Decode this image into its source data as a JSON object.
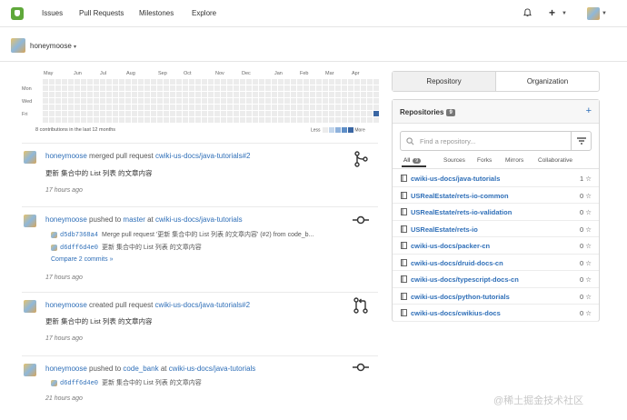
{
  "nav": {
    "items": [
      "Issues",
      "Pull Requests",
      "Milestones",
      "Explore"
    ],
    "plus_label": "+"
  },
  "context": {
    "username": "honeymoose",
    "caret": "▾"
  },
  "heatmap": {
    "months": [
      "May",
      "Jun",
      "Jul",
      "Aug",
      "Sep",
      "Oct",
      "Nov",
      "Dec",
      "Jan",
      "Feb",
      "Mar",
      "Apr"
    ],
    "days": [
      "Mon",
      "Wed",
      "Fri"
    ],
    "caption": "8 contributions in the last 12 months",
    "legend_less": "Less",
    "legend_more": "More",
    "legend_colors": [
      "#ececec",
      "#c3d6ec",
      "#8fb2dc",
      "#5f8fc8",
      "#3a66a3"
    ]
  },
  "feed": [
    {
      "user": "honeymoose",
      "action": "merged pull request",
      "target": "cwiki-us-docs/java-tutorials#2",
      "message": "更新 集合中的 List 列表 的文章内容",
      "time": "17 hours ago"
    },
    {
      "user": "honeymoose",
      "action": "pushed to",
      "branch": "master",
      "at": "at",
      "target": "cwiki-us-docs/java-tutorials",
      "commits": [
        {
          "sha": "d5db7368a4",
          "text": "Merge pull request '更新 集合中的 List 列表 的文章内容' (#2) from code_b..."
        },
        {
          "sha": "d6dff6d4e0",
          "text": "更新 集合中的 List 列表 的文章内容"
        }
      ],
      "compare": "Compare 2 commits »",
      "time": "17 hours ago"
    },
    {
      "user": "honeymoose",
      "action": "created pull request",
      "target": "cwiki-us-docs/java-tutorials#2",
      "message": "更新 集合中的 List 列表 的文章内容",
      "time": "17 hours ago"
    },
    {
      "user": "honeymoose",
      "action": "pushed to",
      "branch": "code_bank",
      "at": "at",
      "target": "cwiki-us-docs/java-tutorials",
      "commits": [
        {
          "sha": "d6dff6d4e0",
          "text": "更新 集合中的 List 列表 的文章内容"
        }
      ],
      "time": "21 hours ago"
    }
  ],
  "side": {
    "tabs": [
      "Repository",
      "Organization"
    ],
    "repos_title": "Repositories",
    "repos_count": "9",
    "search_placeholder": "Find a repository...",
    "filters": [
      "All",
      "Sources",
      "Forks",
      "Mirrors",
      "Collaborative"
    ],
    "all_count": "9",
    "repos": [
      {
        "name": "cwiki-us-docs/java-tutorials",
        "stars": "1"
      },
      {
        "name": "USRealEstate/rets-io-common",
        "stars": "0"
      },
      {
        "name": "USRealEstate/rets-io-validation",
        "stars": "0"
      },
      {
        "name": "USRealEstate/rets-io",
        "stars": "0"
      },
      {
        "name": "cwiki-us-docs/packer-cn",
        "stars": "0"
      },
      {
        "name": "cwiki-us-docs/druid-docs-cn",
        "stars": "0"
      },
      {
        "name": "cwiki-us-docs/typescript-docs-cn",
        "stars": "0"
      },
      {
        "name": "cwiki-us-docs/python-tutorials",
        "stars": "0"
      },
      {
        "name": "cwiki-us-docs/cwikius-docs",
        "stars": "0"
      }
    ]
  },
  "watermark": "@稀土掘金技术社区",
  "colors": {
    "link": "#2f6fb8",
    "contribution": "#3a66a3",
    "brand": "#5fa83a"
  }
}
